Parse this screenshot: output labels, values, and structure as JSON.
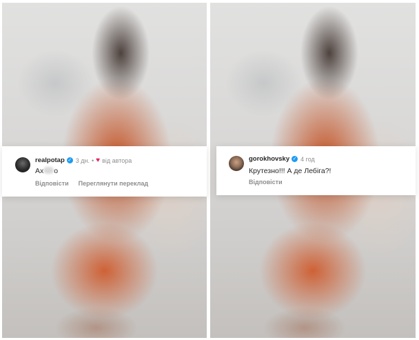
{
  "left_comment": {
    "username": "realpotap",
    "time": "3 дн.",
    "separator": "•",
    "liked_by": "від автора",
    "text_before": "Ах",
    "text_after": "о",
    "actions": [
      "Відповісти",
      "Переглянути переклад"
    ]
  },
  "right_comment": {
    "username": "gorokhovsky",
    "time": "4 год",
    "text": "Крутезно!!! А де Лебіга?!",
    "actions": [
      "Відповісти"
    ]
  },
  "colors": {
    "verified": "#1d9bf0",
    "heart": "#e0245e",
    "text": "#262626",
    "muted": "#8e8e8e"
  },
  "icons": {
    "verified": "verified-badge-icon",
    "heart": "heart-icon"
  }
}
